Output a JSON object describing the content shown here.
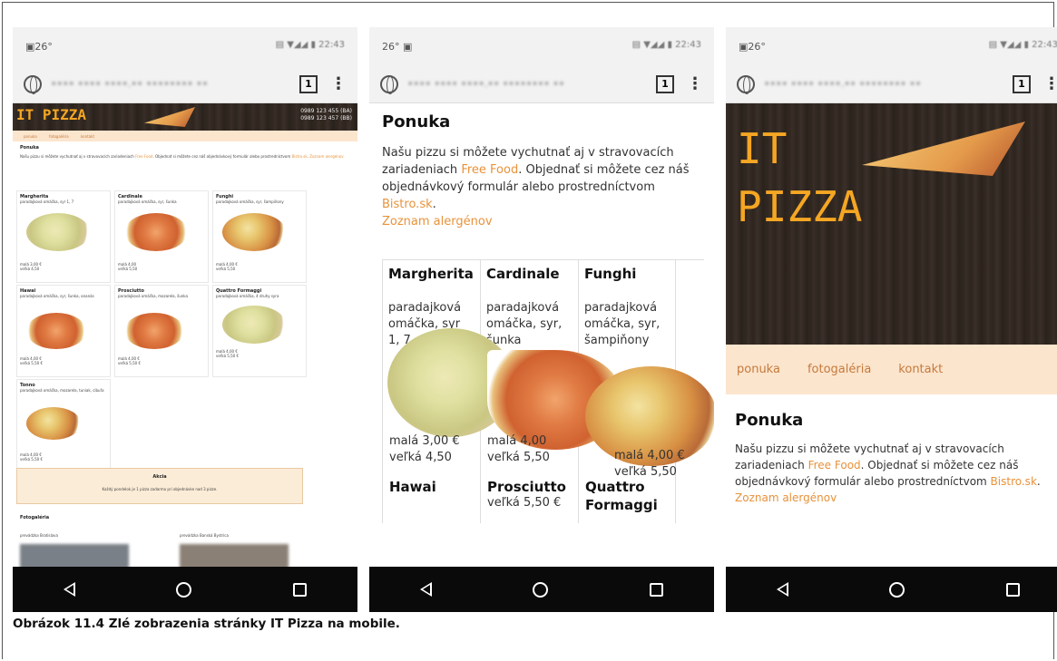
{
  "status_time": "26°",
  "url_tab_count": "1",
  "site": {
    "logo": "IT PIZZA",
    "logo_line1": "IT",
    "logo_line2": "PIZZA",
    "phone1": "0989 123 455 (BA)",
    "phone2": "0989 123 457 (BB)",
    "menu": [
      "ponuka",
      "fotogaléria",
      "kontakt"
    ],
    "section_title": "Ponuka",
    "intro_text_before": "Našu pizzu si môžete vychutnať aj v stravovacích zariadeniach ",
    "intro_link_food": "Free Food",
    "intro_text_mid": ". Objednať si môžete cez náš objednávkový formulár alebo prostredníctvom ",
    "intro_link_bistro": "Bistro.sk",
    "intro_text_end": ".",
    "allergens_link": "Zoznam alergénov",
    "phone3_nums": [
      "09",
      "12",
      "45",
      "(B",
      "09",
      "12",
      "45",
      "(B"
    ]
  },
  "pizzas": [
    {
      "name": "Margherita",
      "desc": "paradajková omáčka, syr 1, 7",
      "small": "malá 3,00 €",
      "large": "veľká 4,50"
    },
    {
      "name": "Cardinale",
      "desc": "paradajková omáčka, syr, šunka",
      "small": "malá 4,00",
      "large": "veľká 5,50"
    },
    {
      "name": "Funghi",
      "desc": "paradajková omáčka, syr, šampiňony",
      "small": "malá 4,00 €",
      "large": "veľká 5,50"
    },
    {
      "name": "Hawai",
      "desc": "paradajková omáčka, syr, šunka, ananás",
      "small": "malá 4,00 €",
      "large": "veľká 5,50 €"
    },
    {
      "name": "Prosciutto",
      "desc": "paradajková omáčka, mozarela, šunka",
      "small": "malá 4,00 €",
      "large": "veľká 5,50 €"
    },
    {
      "name": "Quattro Formaggi",
      "desc": "paradajková omáčka, 4 druhy syra",
      "small": "malá 4,00 €",
      "large": "veľká 5,50 €"
    },
    {
      "name": "Tonno",
      "desc": "paradajková omáčka, mozarela, tuniak, cibuľa",
      "small": "malá 4,00 €",
      "large": "veľká 5,50 €"
    }
  ],
  "phone2_overlap": {
    "col3_price": "malá 4,00 €",
    "col3_large": "veľká 5,50",
    "row2": [
      "Hawai",
      "Prosciutto",
      "Quattro",
      "Formaggi"
    ]
  },
  "akcia": {
    "title": "Akcia",
    "text": "Každý pondelok je 1 pizza zadarmo pri objednávke nad 3 pizze."
  },
  "gallery": {
    "title": "Fotogaléria",
    "items": [
      "prevádzka Bratislava",
      "prevádzka Banská Bystrica"
    ]
  },
  "caption": "Obrázok 11.4 Zlé zobrazenia stránky IT Pizza na mobile."
}
